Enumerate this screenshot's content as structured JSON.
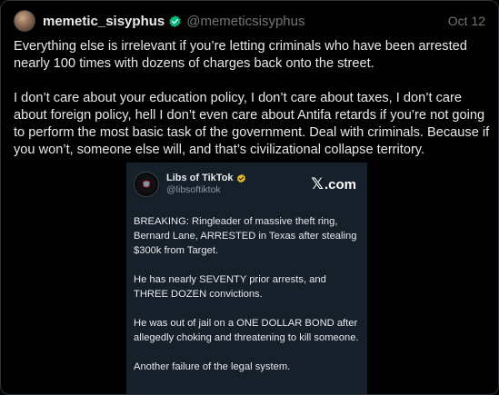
{
  "tweet": {
    "display_name": "memetic_sisyphus",
    "handle": "@memeticsisyphus",
    "date": "Oct 12",
    "paragraphs": [
      "Everything else is irrelevant if you’re letting criminals who have been arrested nearly 100 times with dozens of charges back onto the street.",
      "I don’t care about your education policy, I don’t care about taxes, I don’t care about foreign policy, hell I don’t even care about Antifa retards if you’re not going to perform the most basic task of the government. Deal with criminals. Because if you won’t, someone else will, and that’s civilizational collapse territory."
    ]
  },
  "embed": {
    "display_name": "Libs of TikTok",
    "handle": "@libsoftiktok",
    "brand": ".com",
    "paragraphs": [
      "BREAKING: Ringleader of massive theft ring, Bernard Lane, ARRESTED in Texas after stealing $300k from Target.",
      "He has nearly SEVENTY prior arrests, and THREE DOZEN convictions.",
      "He was out of jail on a ONE DOLLAR BOND after allegedly choking and threatening to kill someone.",
      "Another failure of the legal system."
    ]
  },
  "colors": {
    "background": "#000000",
    "text": "#e7e9ea",
    "muted": "#71767b",
    "verified_green": "#00ba7c",
    "verified_gold": "#e8b923",
    "embed_bg": "#15202b"
  },
  "icons": {
    "author_badge": "verified-badge-icon",
    "embed_badge": "gold-verified-badge-icon",
    "embed_brand": "x-logo-icon"
  }
}
